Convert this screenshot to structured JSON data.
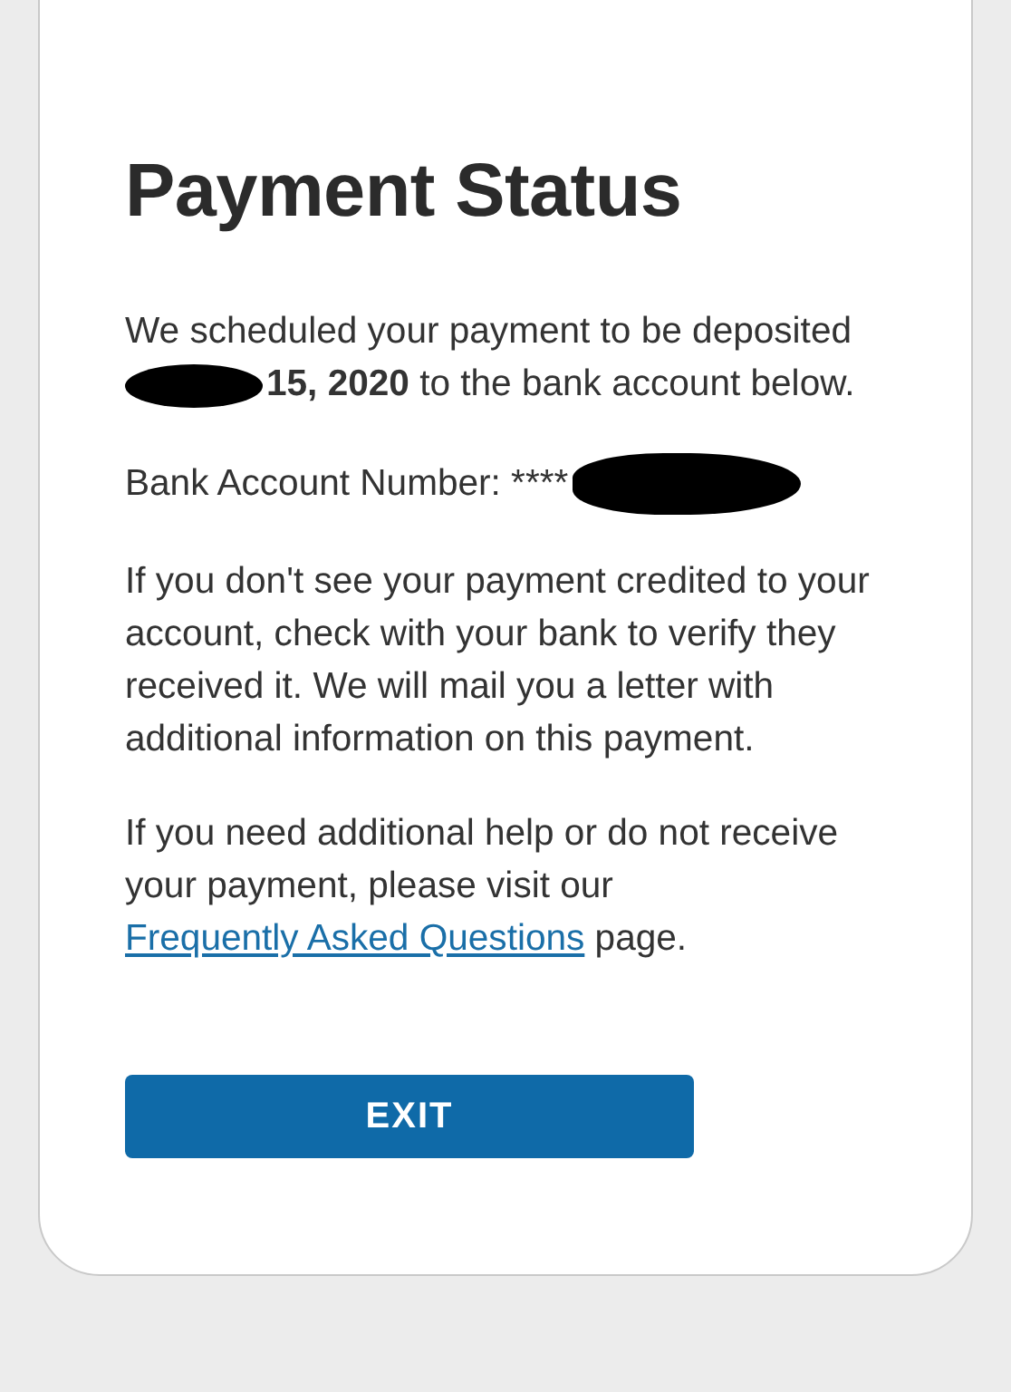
{
  "title": "Payment Status",
  "deposit": {
    "first_line": "We scheduled your payment to be deposited",
    "second_line": "**15, 2020** to the bank account below.",
    "date_redacted": true
  },
  "account": {
    "label": "Bank Account Number: ****",
    "number_redacted": true
  },
  "notice": "If you don't see your payment credited to your account, check with your bank to verify they received it. We will mail you a letter with additional information on this payment.",
  "help": {
    "before": "If you need additional help or do not receive your payment, please visit our",
    "link": "Frequently Asked Questions",
    "after": "page."
  },
  "button": "EXIT"
}
